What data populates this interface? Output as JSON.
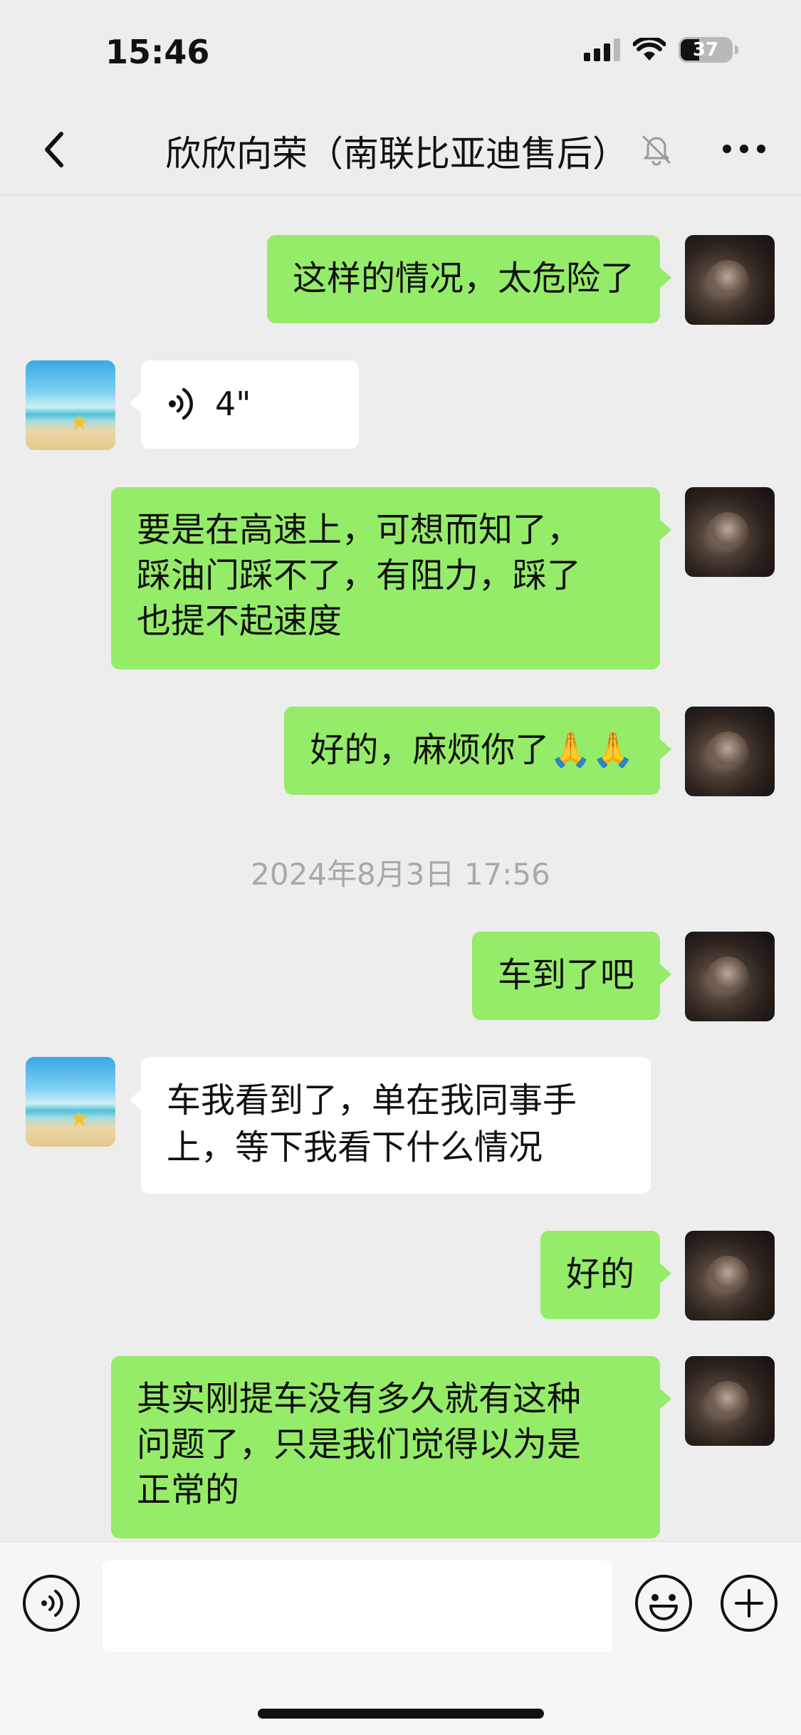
{
  "status": {
    "time": "15:46",
    "battery": "37"
  },
  "nav": {
    "title": "欣欣向荣（南联比亚迪售后）"
  },
  "messages": [
    {
      "from": "me",
      "text": "这样的情况，太危险了"
    },
    {
      "from": "them",
      "type": "voice",
      "duration": "4\""
    },
    {
      "from": "me",
      "lines": [
        "要是在高速上，可想而知了，",
        "踩油门踩不了，有阻力，踩了",
        "也提不起速度"
      ]
    },
    {
      "from": "me",
      "text": "好的，麻烦你了🙏🙏"
    },
    {
      "timestamp": "2024年8月3日 17:56"
    },
    {
      "from": "me",
      "text": "车到了吧"
    },
    {
      "from": "them",
      "lines": [
        "车我看到了，单在我同事手",
        "上，等下我看下什么情况"
      ]
    },
    {
      "from": "me",
      "text": "好的"
    },
    {
      "from": "me",
      "lines": [
        "其实刚提车没有多久就有这种",
        "问题了，只是我们觉得以为是",
        "正常的"
      ]
    }
  ],
  "input": {
    "value": ""
  },
  "icons": {
    "back": "chevron-left-icon",
    "mute": "bell-slash-icon",
    "more": "ellipsis-icon",
    "voice": "voice-icon",
    "emoji": "smiley-icon",
    "plus": "plus-icon"
  },
  "colors": {
    "my_bubble": "#95ec69",
    "their_bubble": "#ffffff",
    "background": "#ededed"
  }
}
